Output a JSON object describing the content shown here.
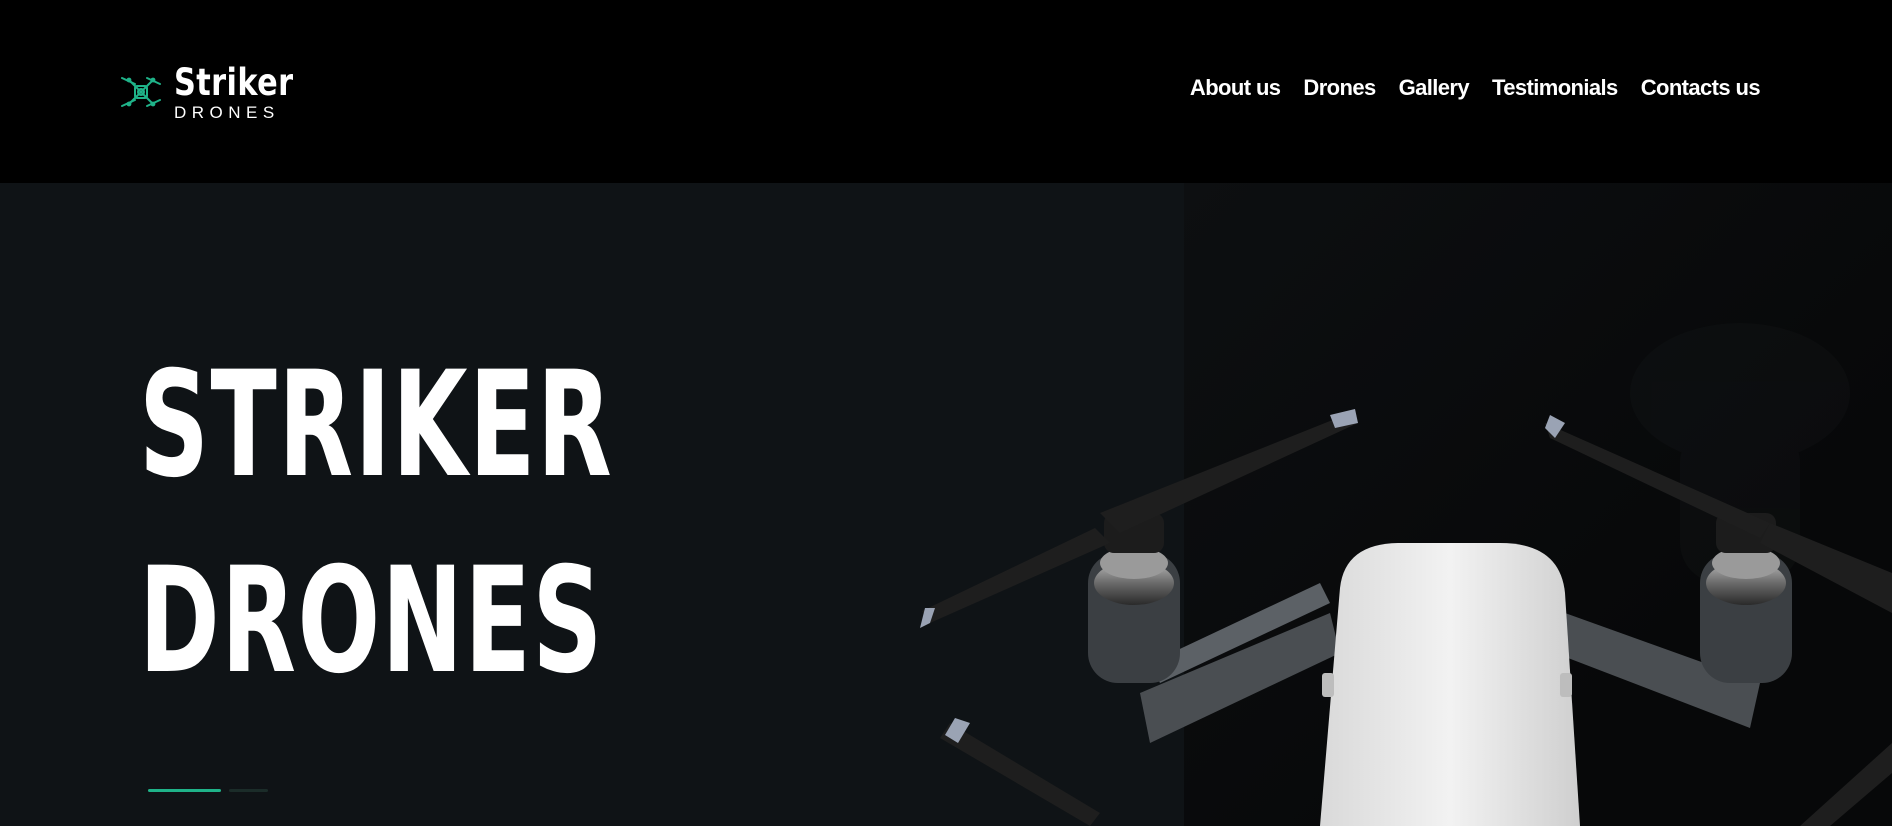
{
  "brand": {
    "name": "Striker",
    "tagline": "DRONES",
    "logo_icon": "quadcopter-icon",
    "accent_color": "#1fb389"
  },
  "nav": {
    "items": [
      {
        "label": "About us"
      },
      {
        "label": "Drones"
      },
      {
        "label": "Gallery"
      },
      {
        "label": "Testimonials"
      },
      {
        "label": "Contacts us"
      }
    ]
  },
  "hero": {
    "title_line1": "STRIKER",
    "title_line2": "DRONES",
    "background_color": "#0f1316",
    "image": "white-quadcopter-drone",
    "slides": {
      "count": 2,
      "active": 1
    }
  }
}
